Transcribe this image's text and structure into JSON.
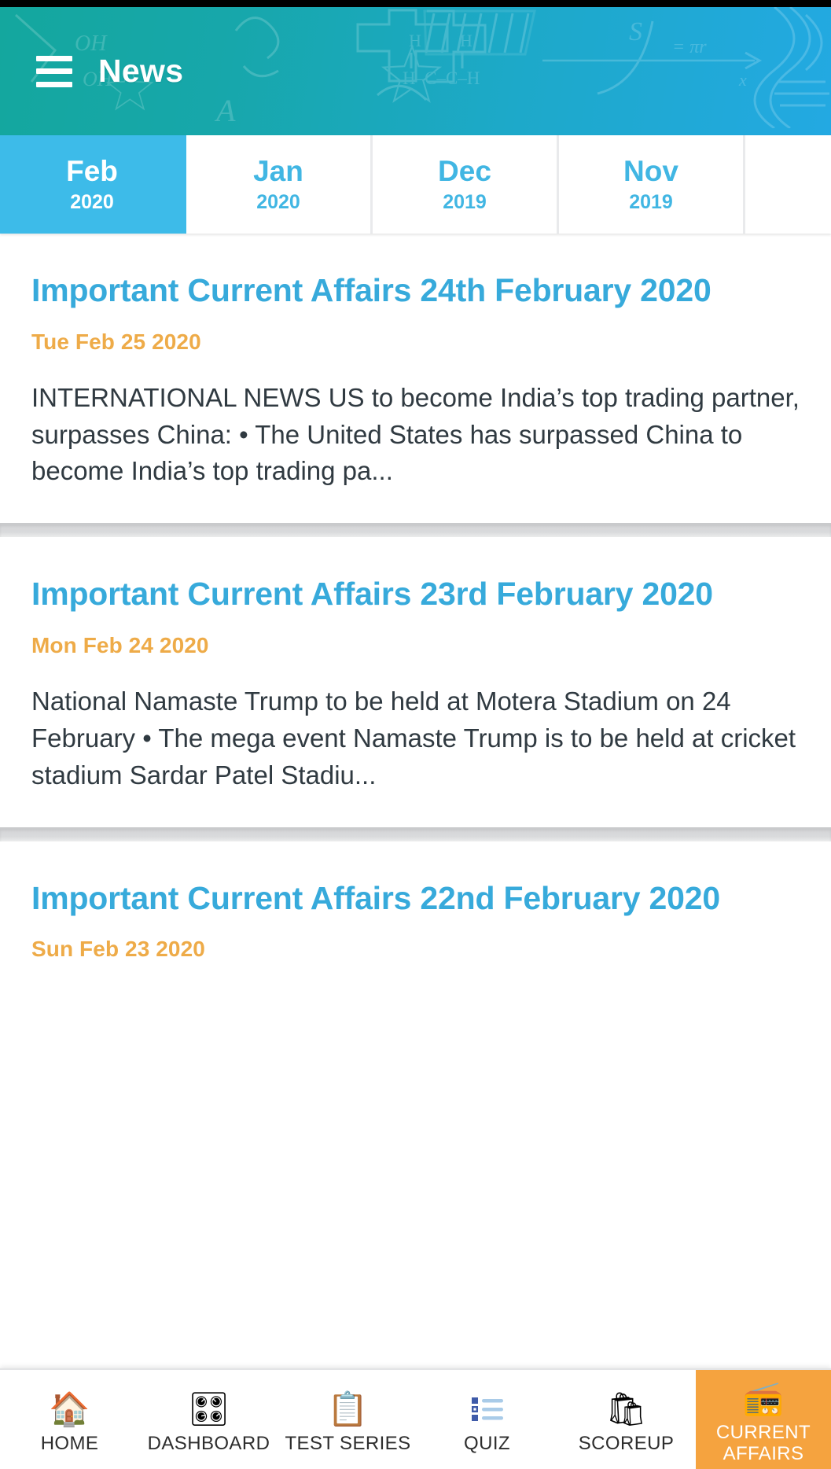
{
  "statusbar": {
    "present": true
  },
  "header": {
    "menu_icon": "hamburger-menu-icon",
    "title": "News",
    "gradient_from": "#14a79e",
    "gradient_to": "#23a9e2"
  },
  "tabs": {
    "active_index": 0,
    "active_bg": "#3dbbe9",
    "inactive_text": "#41b6e3",
    "items": [
      {
        "month": "Feb",
        "year": "2020"
      },
      {
        "month": "Jan",
        "year": "2020"
      },
      {
        "month": "Dec",
        "year": "2019"
      },
      {
        "month": "Nov",
        "year": "2019"
      }
    ]
  },
  "articles": [
    {
      "title": "Important Current Affairs 24th February 2020",
      "date": "Tue Feb 25 2020",
      "excerpt": "INTERNATIONAL NEWS US to become India’s top trading partner, surpasses China: • The United States has surpassed China to become India’s top trading pa..."
    },
    {
      "title": "Important Current Affairs 23rd February 2020",
      "date": "Mon Feb 24 2020",
      "excerpt": "National Namaste Trump to be held at Motera Stadium on 24 February • The mega event Namaste Trump is to be held at cricket stadium Sardar Patel Stadiu..."
    },
    {
      "title": "Important Current Affairs 22nd February 2020",
      "date": "Sun Feb 23 2020",
      "excerpt": ""
    }
  ],
  "colors": {
    "title_blue": "#37aadb",
    "date_orange": "#eeab48",
    "body_text": "#303a41",
    "active_nav_orange": "#f5a33f"
  },
  "bottom_nav": {
    "active_index": 5,
    "items": [
      {
        "label": "HOME",
        "icon": "house-icon",
        "glyph": "🏠"
      },
      {
        "label": "DASHBOARD",
        "icon": "gauge-icon",
        "glyph": "🎛"
      },
      {
        "label": "TEST SERIES",
        "icon": "clipboard-grade-icon",
        "glyph": "📋"
      },
      {
        "label": "QUIZ",
        "icon": "bullet-list-icon",
        "glyph": "☰"
      },
      {
        "label": "SCOREUP",
        "icon": "shopping-bag-icon",
        "glyph": "🛍"
      },
      {
        "label": "CURRENT AFFAIRS",
        "icon": "radio-icon",
        "glyph": "📻"
      }
    ]
  }
}
